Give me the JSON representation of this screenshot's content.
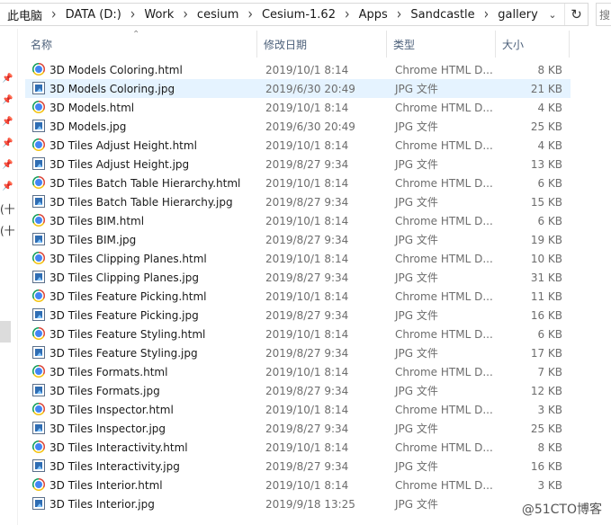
{
  "address": {
    "breadcrumbs": [
      "此电脑",
      "DATA (D:)",
      "Work",
      "cesium",
      "Cesium-1.62",
      "Apps",
      "Sandcastle",
      "gallery"
    ],
    "separator": "›",
    "dropdown_icon": "chevron-down-icon",
    "refresh_icon": "refresh-icon",
    "search_placeholder": "搜"
  },
  "nav": {
    "cut_labels": [
      "(十",
      "(十"
    ]
  },
  "columns": {
    "name": "名称",
    "date": "修改日期",
    "type": "类型",
    "size": "大小"
  },
  "files": [
    {
      "name": "3D Models Coloring.html",
      "date": "2019/10/1 8:14",
      "type": "Chrome HTML D...",
      "size": "8 KB",
      "kind": "chrome",
      "selected": false
    },
    {
      "name": "3D Models Coloring.jpg",
      "date": "2019/6/30 20:49",
      "type": "JPG 文件",
      "size": "21 KB",
      "kind": "jpg",
      "selected": true
    },
    {
      "name": "3D Models.html",
      "date": "2019/10/1 8:14",
      "type": "Chrome HTML D...",
      "size": "4 KB",
      "kind": "chrome",
      "selected": false
    },
    {
      "name": "3D Models.jpg",
      "date": "2019/6/30 20:49",
      "type": "JPG 文件",
      "size": "25 KB",
      "kind": "jpg",
      "selected": false
    },
    {
      "name": "3D Tiles Adjust Height.html",
      "date": "2019/10/1 8:14",
      "type": "Chrome HTML D...",
      "size": "4 KB",
      "kind": "chrome",
      "selected": false
    },
    {
      "name": "3D Tiles Adjust Height.jpg",
      "date": "2019/8/27 9:34",
      "type": "JPG 文件",
      "size": "13 KB",
      "kind": "jpg",
      "selected": false
    },
    {
      "name": "3D Tiles Batch Table Hierarchy.html",
      "date": "2019/10/1 8:14",
      "type": "Chrome HTML D...",
      "size": "6 KB",
      "kind": "chrome",
      "selected": false
    },
    {
      "name": "3D Tiles Batch Table Hierarchy.jpg",
      "date": "2019/8/27 9:34",
      "type": "JPG 文件",
      "size": "15 KB",
      "kind": "jpg",
      "selected": false
    },
    {
      "name": "3D Tiles BIM.html",
      "date": "2019/10/1 8:14",
      "type": "Chrome HTML D...",
      "size": "6 KB",
      "kind": "chrome",
      "selected": false
    },
    {
      "name": "3D Tiles BIM.jpg",
      "date": "2019/8/27 9:34",
      "type": "JPG 文件",
      "size": "19 KB",
      "kind": "jpg",
      "selected": false
    },
    {
      "name": "3D Tiles Clipping Planes.html",
      "date": "2019/10/1 8:14",
      "type": "Chrome HTML D...",
      "size": "10 KB",
      "kind": "chrome",
      "selected": false
    },
    {
      "name": "3D Tiles Clipping Planes.jpg",
      "date": "2019/8/27 9:34",
      "type": "JPG 文件",
      "size": "31 KB",
      "kind": "jpg",
      "selected": false
    },
    {
      "name": "3D Tiles Feature Picking.html",
      "date": "2019/10/1 8:14",
      "type": "Chrome HTML D...",
      "size": "11 KB",
      "kind": "chrome",
      "selected": false
    },
    {
      "name": "3D Tiles Feature Picking.jpg",
      "date": "2019/8/27 9:34",
      "type": "JPG 文件",
      "size": "16 KB",
      "kind": "jpg",
      "selected": false
    },
    {
      "name": "3D Tiles Feature Styling.html",
      "date": "2019/10/1 8:14",
      "type": "Chrome HTML D...",
      "size": "6 KB",
      "kind": "chrome",
      "selected": false
    },
    {
      "name": "3D Tiles Feature Styling.jpg",
      "date": "2019/8/27 9:34",
      "type": "JPG 文件",
      "size": "17 KB",
      "kind": "jpg",
      "selected": false
    },
    {
      "name": "3D Tiles Formats.html",
      "date": "2019/10/1 8:14",
      "type": "Chrome HTML D...",
      "size": "7 KB",
      "kind": "chrome",
      "selected": false
    },
    {
      "name": "3D Tiles Formats.jpg",
      "date": "2019/8/27 9:34",
      "type": "JPG 文件",
      "size": "12 KB",
      "kind": "jpg",
      "selected": false
    },
    {
      "name": "3D Tiles Inspector.html",
      "date": "2019/10/1 8:14",
      "type": "Chrome HTML D...",
      "size": "3 KB",
      "kind": "chrome",
      "selected": false
    },
    {
      "name": "3D Tiles Inspector.jpg",
      "date": "2019/8/27 9:34",
      "type": "JPG 文件",
      "size": "25 KB",
      "kind": "jpg",
      "selected": false
    },
    {
      "name": "3D Tiles Interactivity.html",
      "date": "2019/10/1 8:14",
      "type": "Chrome HTML D...",
      "size": "8 KB",
      "kind": "chrome",
      "selected": false
    },
    {
      "name": "3D Tiles Interactivity.jpg",
      "date": "2019/8/27 9:34",
      "type": "JPG 文件",
      "size": "16 KB",
      "kind": "jpg",
      "selected": false
    },
    {
      "name": "3D Tiles Interior.html",
      "date": "2019/10/1 8:14",
      "type": "Chrome HTML D...",
      "size": "3 KB",
      "kind": "chrome",
      "selected": false
    },
    {
      "name": "3D Tiles Interior.jpg",
      "date": "2019/9/18 13:25",
      "type": "JPG 文件",
      "size": "",
      "kind": "jpg",
      "selected": false
    }
  ],
  "watermark": "@51CTO博客",
  "colors": {
    "selected_row": "#e5f3ff",
    "header_text": "#4c607a",
    "meta_text": "#6d6d6d"
  }
}
